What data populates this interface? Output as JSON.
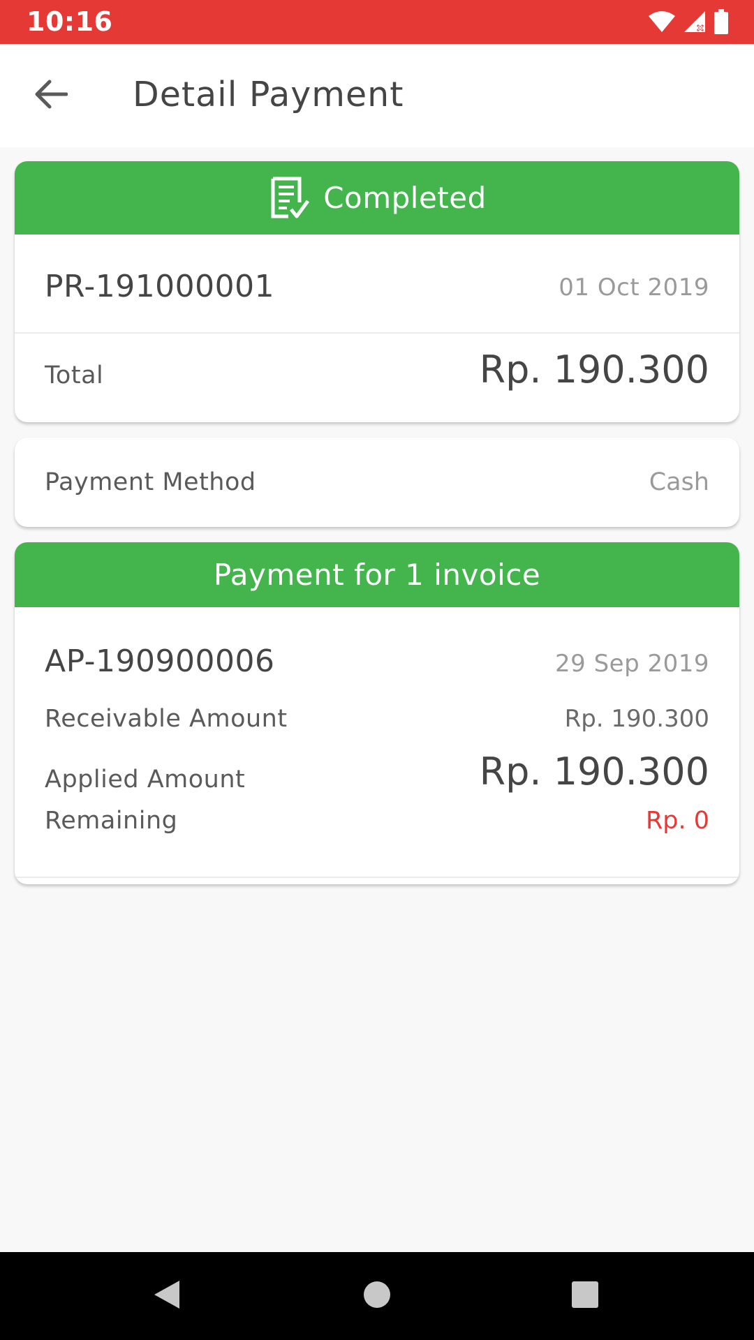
{
  "status_bar": {
    "time": "10:16",
    "icons": [
      "wifi-icon",
      "signal-icon",
      "battery-icon"
    ]
  },
  "app_bar": {
    "title": "Detail Payment",
    "back_icon": "arrow-back-icon"
  },
  "payment": {
    "status": "Completed",
    "status_icon": "receipt-check-icon",
    "number": "PR-191000001",
    "date": "01 Oct 2019",
    "total_label": "Total",
    "total_value": "Rp. 190.300"
  },
  "method": {
    "label": "Payment Method",
    "value": "Cash"
  },
  "invoices": {
    "header": "Payment for 1 invoice",
    "items": [
      {
        "number": "AP-190900006",
        "date": "29 Sep 2019",
        "receivable_label": "Receivable Amount",
        "receivable_value": "Rp. 190.300",
        "applied_label": "Applied Amount",
        "applied_value": "Rp. 190.300",
        "remaining_label": "Remaining",
        "remaining_value": "Rp. 0"
      }
    ]
  },
  "colors": {
    "status_bar": "#e53935",
    "accent_green": "#43b54c",
    "remaining_red": "#e53935"
  },
  "nav_bar": {
    "icons": [
      "back-triangle-icon",
      "home-circle-icon",
      "recents-square-icon"
    ]
  }
}
